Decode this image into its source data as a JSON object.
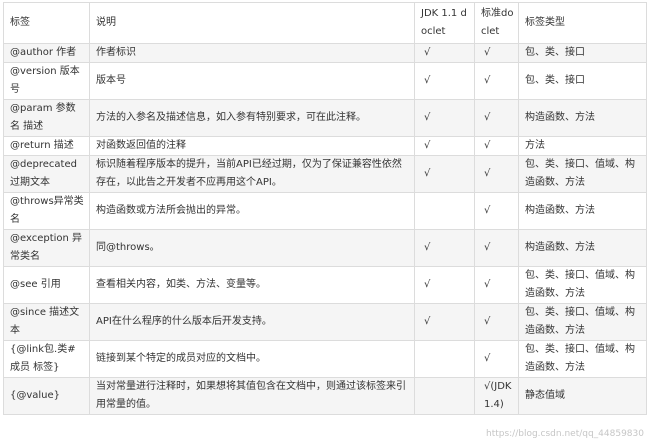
{
  "table": {
    "headers": [
      "标签",
      "说明",
      "JDK 1.1 doclet",
      "标准doclet",
      "标签类型"
    ],
    "rows": [
      {
        "tag": "@author 作者",
        "desc": "作者标识",
        "jdk11": "√",
        "std": "√",
        "type": "包、类、接口"
      },
      {
        "tag": "@version 版本号",
        "desc": "版本号",
        "jdk11": "√",
        "std": "√",
        "type": "包、类、接口"
      },
      {
        "tag": "@param 参数名 描述",
        "desc": "方法的入参名及描述信息，如入参有特别要求，可在此注释。",
        "jdk11": "√",
        "std": "√",
        "type": "构造函数、方法"
      },
      {
        "tag": "@return 描述",
        "desc": "对函数返回值的注释",
        "jdk11": "√",
        "std": "√",
        "type": "方法"
      },
      {
        "tag": "@deprecated 过期文本",
        "desc": "标识随着程序版本的提升，当前API已经过期，仅为了保证兼容性依然存在，以此告之开发者不应再用这个API。",
        "jdk11": "√",
        "std": "√",
        "type": "包、类、接口、值域、构造函数、方法"
      },
      {
        "tag": "@throws异常类名",
        "desc": "构造函数或方法所会抛出的异常。",
        "jdk11": "",
        "std": "√",
        "type": "构造函数、方法"
      },
      {
        "tag": "@exception 异常类名",
        "desc": "同@throws。",
        "jdk11": "√",
        "std": "√",
        "type": "构造函数、方法"
      },
      {
        "tag": "@see 引用",
        "desc": "查看相关内容，如类、方法、变量等。",
        "jdk11": "√",
        "std": "√",
        "type": "包、类、接口、值域、构造函数、方法"
      },
      {
        "tag": "@since 描述文本",
        "desc": "API在什么程序的什么版本后开发支持。",
        "jdk11": "√",
        "std": "√",
        "type": "包、类、接口、值域、构造函数、方法"
      },
      {
        "tag": "{@link包.类#成员 标签}",
        "desc": "链接到某个特定的成员对应的文档中。",
        "jdk11": "",
        "std": "√",
        "type": "包、类、接口、值域、构造函数、方法"
      },
      {
        "tag": "{@value}",
        "desc": "当对常量进行注释时，如果想将其值包含在文档中，则通过该标签来引用常量的值。",
        "jdk11": "",
        "std": "√(JDK1.4)",
        "type": "静态值域"
      }
    ]
  },
  "watermark": "https://blog.csdn.net/qq_44859830"
}
